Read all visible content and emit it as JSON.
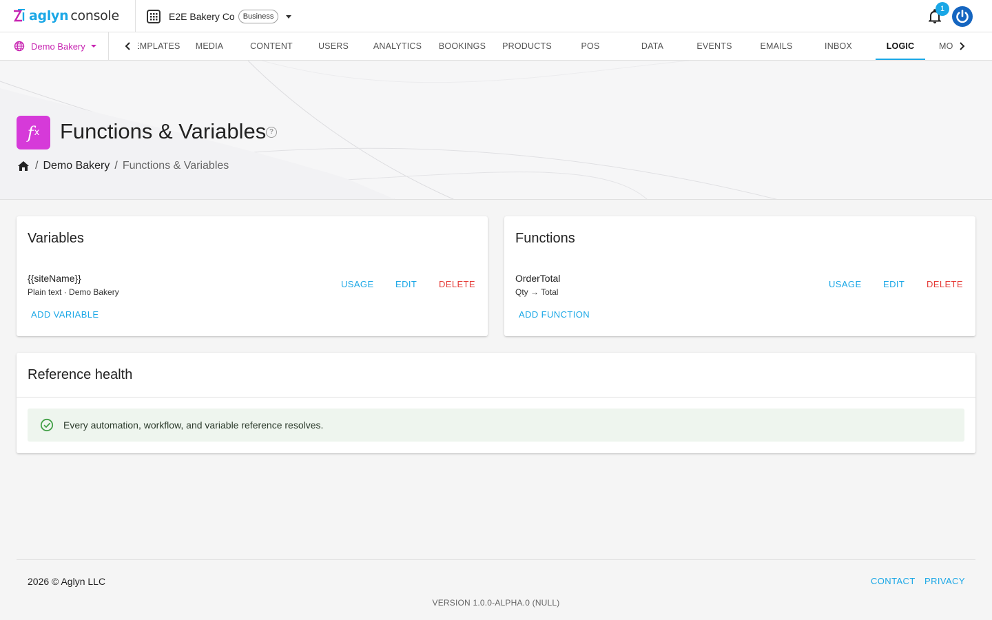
{
  "app": {
    "logo_primary": "aglyn",
    "logo_secondary": "console",
    "org_name": "E2E Bakery Co",
    "org_plan": "Business",
    "notification_count": "1"
  },
  "nav": {
    "site": "Demo Bakery",
    "tabs": [
      "TEMPLATES",
      "MEDIA",
      "CONTENT",
      "USERS",
      "ANALYTICS",
      "BOOKINGS",
      "PRODUCTS",
      "POS",
      "DATA",
      "EVENTS",
      "EMAILS",
      "INBOX",
      "LOGIC",
      "MORE"
    ],
    "active_tab": "LOGIC"
  },
  "page": {
    "title": "Functions & Variables",
    "icon_label": "f",
    "icon_sub": "x",
    "breadcrumb": [
      "Demo Bakery",
      "Functions & Variables"
    ]
  },
  "variables": {
    "title": "Variables",
    "items": [
      {
        "name": "{{siteName}}",
        "meta": "Plain text · Demo Bakery"
      }
    ],
    "usage_label": "USAGE",
    "edit_label": "EDIT",
    "delete_label": "DELETE",
    "add_label": "ADD VARIABLE"
  },
  "functions": {
    "title": "Functions",
    "items": [
      {
        "name": "OrderTotal",
        "meta": "Qty → Total"
      }
    ],
    "usage_label": "USAGE",
    "edit_label": "EDIT",
    "delete_label": "DELETE",
    "add_label": "ADD FUNCTION"
  },
  "health": {
    "title": "Reference health",
    "message": "Every automation, workflow, and variable reference resolves."
  },
  "footer": {
    "copyright": "2026 © Aglyn LLC",
    "contact": "CONTACT",
    "privacy": "PRIVACY",
    "version": "VERSION 1.0.0-ALPHA.0 (NULL)"
  },
  "colors": {
    "brand_blue": "#1aa7e6",
    "brand_magenta": "#c724b1",
    "danger": "#e53935",
    "success": "#43a047"
  }
}
